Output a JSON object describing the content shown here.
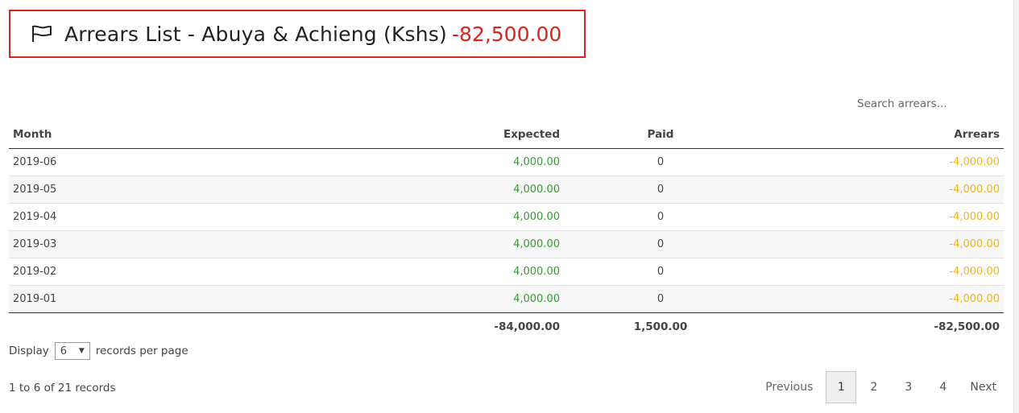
{
  "header": {
    "title": "Arrears List - Abuya & Achieng (Kshs)",
    "amount": "-82,500.00"
  },
  "search": {
    "placeholder": "Search arrears..."
  },
  "table": {
    "columns": [
      "Month",
      "Expected",
      "Paid",
      "Arrears"
    ],
    "rows": [
      {
        "month": "2019-06",
        "expected": "4,000.00",
        "paid": "0",
        "arrears": "-4,000.00"
      },
      {
        "month": "2019-05",
        "expected": "4,000.00",
        "paid": "0",
        "arrears": "-4,000.00"
      },
      {
        "month": "2019-04",
        "expected": "4,000.00",
        "paid": "0",
        "arrears": "-4,000.00"
      },
      {
        "month": "2019-03",
        "expected": "4,000.00",
        "paid": "0",
        "arrears": "-4,000.00"
      },
      {
        "month": "2019-02",
        "expected": "4,000.00",
        "paid": "0",
        "arrears": "-4,000.00"
      },
      {
        "month": "2019-01",
        "expected": "4,000.00",
        "paid": "0",
        "arrears": "-4,000.00"
      }
    ],
    "totals": {
      "expected": "-84,000.00",
      "paid": "1,500.00",
      "arrears": "-82,500.00"
    }
  },
  "display": {
    "prefix": "Display",
    "value": "6",
    "suffix": "records per page"
  },
  "records_info": "1 to 6 of 21 records",
  "pagination": {
    "previous": "Previous",
    "pages": [
      "1",
      "2",
      "3",
      "4"
    ],
    "active": "1",
    "next": "Next"
  },
  "colors": {
    "accent": "#d9251d",
    "expected": "#3a9a35",
    "arrears": "#f0b518"
  }
}
